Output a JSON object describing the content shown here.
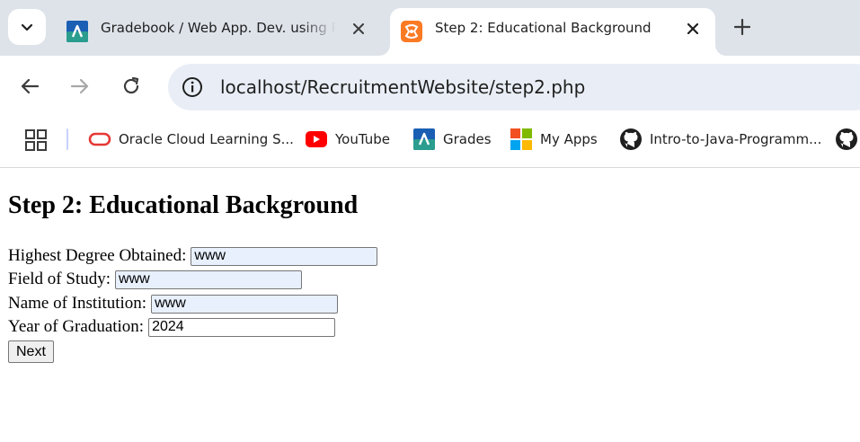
{
  "browser": {
    "tabs": [
      {
        "title": "Gradebook / Web App. Dev. using PHP",
        "active": false,
        "favicon": "canvas-icon"
      },
      {
        "title": "Step 2: Educational Background",
        "active": true,
        "favicon": "xampp-icon"
      }
    ],
    "address_bar": {
      "url": "localhost/RecruitmentWebsite/step2.php"
    },
    "bookmarks": [
      {
        "label": "Oracle Cloud Learning S...",
        "icon": "oracle-icon"
      },
      {
        "label": "YouTube",
        "icon": "youtube-icon"
      },
      {
        "label": "Grades",
        "icon": "canvas-icon"
      },
      {
        "label": "My Apps",
        "icon": "microsoft-icon"
      },
      {
        "label": "Intro-to-Java-Programm...",
        "icon": "github-icon"
      },
      {
        "label": "",
        "icon": "github-icon"
      }
    ]
  },
  "page": {
    "heading": "Step 2: Educational Background",
    "fields": [
      {
        "label": "Highest Degree Obtained:",
        "value": "www"
      },
      {
        "label": "Field of Study:",
        "value": "www"
      },
      {
        "label": "Name of Institution:",
        "value": "www"
      },
      {
        "label": "Year of Graduation:",
        "value": "2024"
      }
    ],
    "submit_label": "Next"
  },
  "colors": {
    "tabstrip": "#dee3ea",
    "omnibox": "#e9eef6",
    "autofill": "#e8f0fe",
    "canvas_blue": "#1a73e8",
    "xampp_orange": "#fb7a24",
    "youtube_red": "#ff0000",
    "oracle_red": "#e53935"
  }
}
